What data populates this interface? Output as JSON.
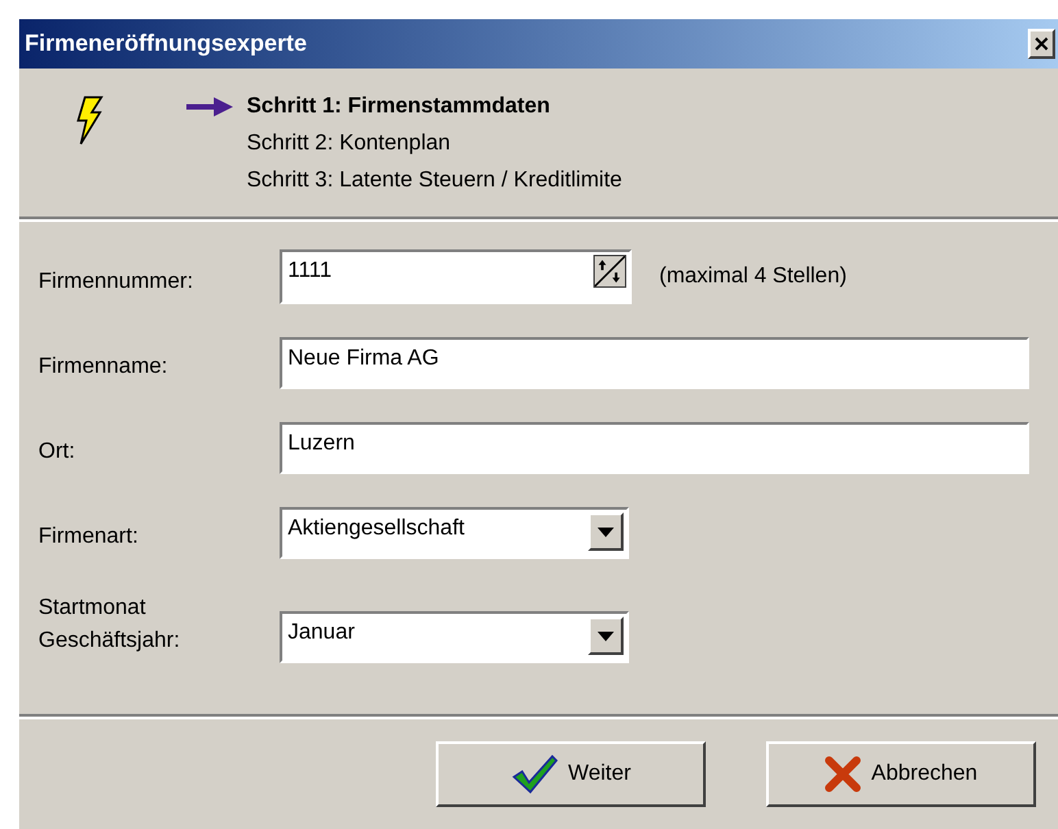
{
  "window": {
    "title": "Firmeneröffnungsexperte"
  },
  "steps": [
    {
      "label": "Schritt 1: Firmenstammdaten",
      "selected": true
    },
    {
      "label": "Schritt 2: Kontenplan",
      "selected": false
    },
    {
      "label": "Schritt 3: Latente Steuern / Kreditlimite",
      "selected": false
    }
  ],
  "fields": [
    {
      "kind": "spinner",
      "label": "Firmennummer:",
      "value": "1111",
      "hint": "(maximal 4 Stellen)"
    },
    {
      "kind": "text",
      "label": "Firmenname:",
      "value": "Neue Firma AG"
    },
    {
      "kind": "text",
      "label": "Ort:",
      "value": "Luzern"
    },
    {
      "kind": "combo",
      "label": "Firmenart:",
      "value": "Aktiengesellschaft"
    },
    {
      "kind": "combo",
      "label": "Startmonat Geschäftsjahr:",
      "value": "Januar"
    }
  ],
  "buttons": [
    {
      "kind": "next",
      "label": "Weiter"
    },
    {
      "kind": "cancel",
      "label": "Abbrechen"
    }
  ]
}
